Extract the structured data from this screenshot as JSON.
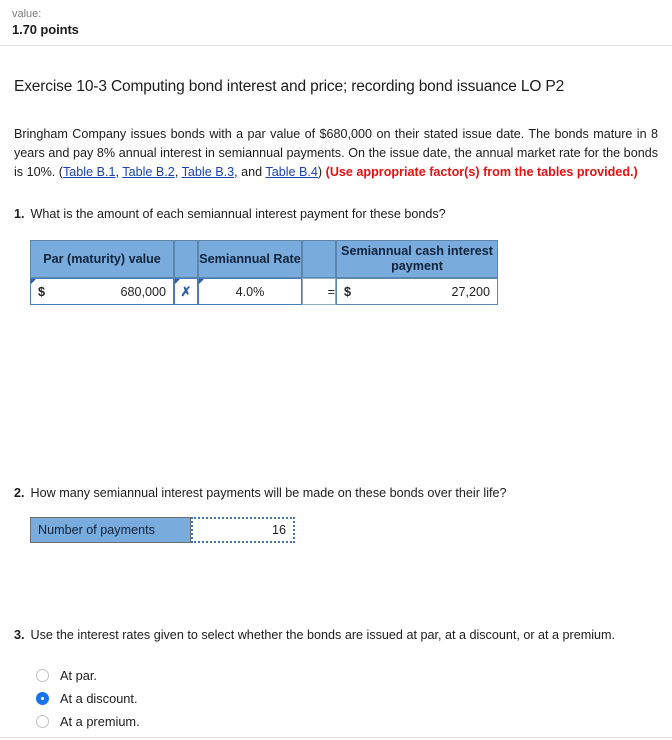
{
  "header": {
    "value_label": "value:",
    "points": "1.70 points"
  },
  "exercise": {
    "title": "Exercise 10-3 Computing bond interest and price; recording bond issuance LO P2",
    "intro_part1": "Bringham Company issues bonds with a par value of $680,000 on their stated issue date. The bonds mature in 8 years and pay 8% annual interest in semiannual payments. On the issue date, the annual market rate for the bonds is 10%. (",
    "link_b1": "Table B.1",
    "sep1": ", ",
    "link_b2": "Table B.2",
    "sep2": ", ",
    "link_b3": "Table B.3",
    "sep3": ", and ",
    "link_b4": "Table B.4",
    "intro_part2": ") ",
    "note_red": "(Use appropriate factor(s) from the tables provided.)"
  },
  "q1": {
    "number": "1.",
    "text": "What is the amount of each semiannual interest payment for these bonds?",
    "headers": {
      "par": "Par (maturity) value",
      "rate": "Semiannual Rate",
      "result": "Semiannual cash interest payment"
    },
    "par_symbol": "$",
    "par_value": "680,000",
    "operator_multiply": "✗",
    "rate_value": "4.0%",
    "operator_equals": "=",
    "result_symbol": "$",
    "result_value": "27,200"
  },
  "q2": {
    "number": "2.",
    "text": "How many semiannual interest payments will be made on these bonds over their life?",
    "label": "Number of payments",
    "value": "16"
  },
  "q3": {
    "number": "3.",
    "text": "Use the interest rates given to select whether the bonds are issued at par, at a discount, or at a premium.",
    "options": [
      {
        "label": "At par.",
        "selected": false
      },
      {
        "label": "At a discount.",
        "selected": true
      },
      {
        "label": "At a premium.",
        "selected": false
      }
    ]
  },
  "colors": {
    "header_blue": "#79abdd",
    "link_blue": "#1a43b5",
    "alert_red": "#e81010",
    "radio_selected": "#1a73e8"
  }
}
